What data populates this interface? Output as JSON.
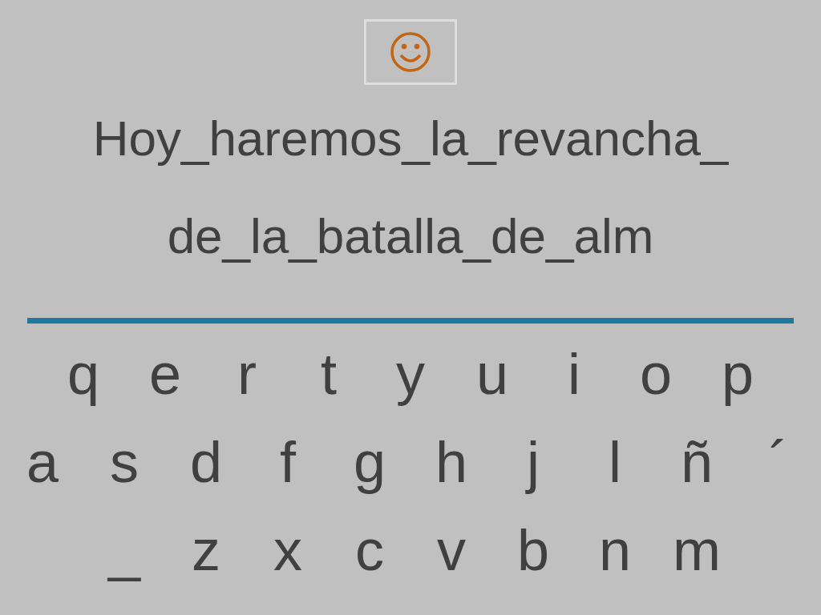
{
  "phrase_lines": [
    "Hoy_haremos_la_revancha_",
    "de_la_batalla_de_alm"
  ],
  "keyboard_rows": [
    [
      "q",
      "e",
      "r",
      "t",
      "y",
      "u",
      "i",
      "o",
      "p"
    ],
    [
      "a",
      "s",
      "d",
      "f",
      "g",
      "h",
      "j",
      "l",
      "ñ",
      "´"
    ],
    [
      "_",
      "z",
      "x",
      "c",
      "v",
      "b",
      "n",
      "m"
    ]
  ]
}
